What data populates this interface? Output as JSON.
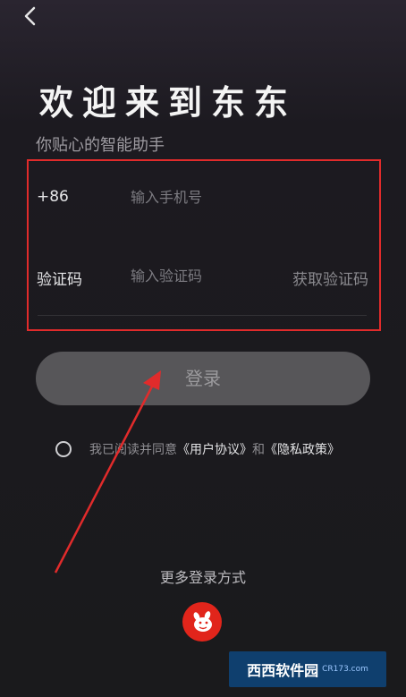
{
  "header": {
    "back_icon": "chevron-left-icon"
  },
  "welcome": {
    "title": "欢迎来到东东",
    "subtitle": "你贴心的智能助手"
  },
  "form": {
    "country_code": "+86",
    "phone_placeholder": "输入手机号",
    "code_label": "验证码",
    "code_placeholder": "输入验证码",
    "get_code": "获取验证码"
  },
  "login": {
    "label": "登录"
  },
  "agreement": {
    "prefix": "我已阅读并同意",
    "user_agreement": "《用户协议》",
    "and": "和",
    "privacy_policy": "《隐私政策》"
  },
  "more": {
    "label": "更多登录方式",
    "jd_icon": "jd-dog-icon"
  },
  "watermark": {
    "brand": "西西软件园",
    "domain": "CR173.com"
  },
  "colors": {
    "highlight_box": "#e12b2b",
    "arrow": "#e12b2b",
    "jd_red": "#e1251b",
    "button_bg": "#575659"
  }
}
